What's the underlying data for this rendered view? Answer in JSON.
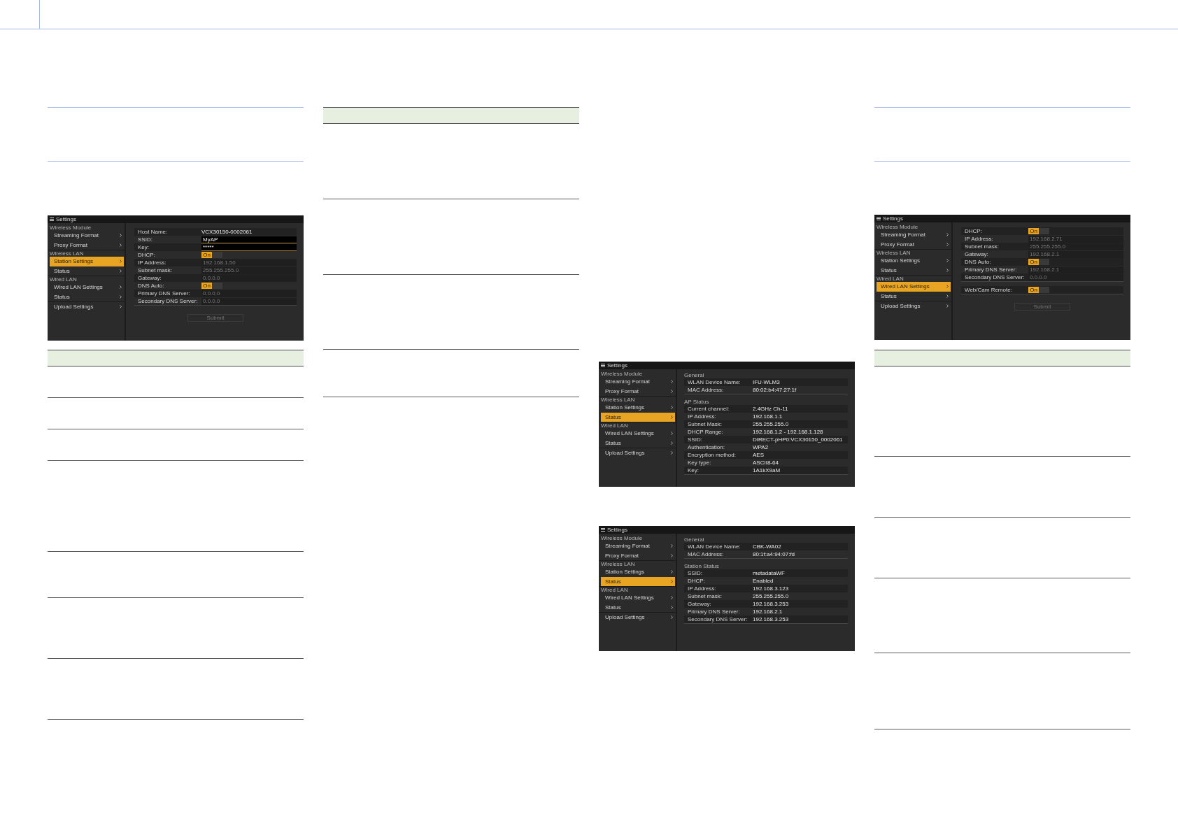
{
  "screenshots": [
    {
      "title": "Settings",
      "sidebar": [
        {
          "heading": "Wireless Module",
          "items": [
            {
              "label": "Streaming Format",
              "selected": false
            },
            {
              "label": "Proxy Format",
              "selected": false
            }
          ]
        },
        {
          "heading": "Wireless LAN",
          "items": [
            {
              "label": "Station Settings",
              "selected": true
            },
            {
              "label": "Status",
              "selected": false
            }
          ]
        },
        {
          "heading": "Wired LAN",
          "items": [
            {
              "label": "Wired LAN Settings",
              "selected": false
            },
            {
              "label": "Status",
              "selected": false
            }
          ]
        },
        {
          "items": [
            {
              "label": "Upload Settings",
              "selected": false
            }
          ]
        }
      ],
      "panel": {
        "kind": "form",
        "sections": [
          {
            "rows": [
              {
                "kind": "static",
                "label": "Host Name:",
                "value": "VCX30150-0002061"
              },
              {
                "kind": "input",
                "label": "SSID:",
                "value": "MyAP",
                "disabled": false
              },
              {
                "kind": "input",
                "label": "Key:",
                "value": "*****",
                "disabled": false
              },
              {
                "kind": "toggle",
                "label": "DHCP:",
                "text": "On",
                "on": true
              },
              {
                "kind": "input",
                "label": "IP Address:",
                "value": "192.168.1.50",
                "disabled": true
              },
              {
                "kind": "input",
                "label": "Subnet mask:",
                "value": "255.255.255.0",
                "disabled": true
              },
              {
                "kind": "input",
                "label": "Gateway:",
                "value": "0.0.0.0",
                "disabled": true
              },
              {
                "kind": "toggle",
                "label": "DNS Auto:",
                "text": "On",
                "on": true
              },
              {
                "kind": "input",
                "label": "Primary DNS Server:",
                "value": "0.0.0.0",
                "disabled": true
              },
              {
                "kind": "input",
                "label": "Secondary DNS Server:",
                "value": "0.0.0.0",
                "disabled": true
              }
            ]
          }
        ],
        "submit": {
          "label": "Submit",
          "disabled": true
        }
      }
    },
    {
      "title": "Settings",
      "sidebar": [
        {
          "heading": "Wireless Module",
          "items": [
            {
              "label": "Streaming Format",
              "selected": false
            },
            {
              "label": "Proxy Format",
              "selected": false
            }
          ]
        },
        {
          "heading": "Wireless LAN",
          "items": [
            {
              "label": "Station Settings",
              "selected": false
            },
            {
              "label": "Status",
              "selected": true
            }
          ]
        },
        {
          "heading": "Wired LAN",
          "items": [
            {
              "label": "Wired LAN Settings",
              "selected": false
            },
            {
              "label": "Status",
              "selected": false
            }
          ]
        },
        {
          "items": [
            {
              "label": "Upload Settings",
              "selected": false
            }
          ]
        }
      ],
      "panel": {
        "kind": "status",
        "sections": [
          {
            "heading": "General",
            "rows": [
              {
                "kind": "static",
                "label": "WLAN Device Name:",
                "value": "IFU-WLM3"
              },
              {
                "kind": "static",
                "label": "MAC Address:",
                "value": "80:02:b4:47:27:1f"
              }
            ]
          },
          {
            "heading": "AP Status",
            "rows": [
              {
                "kind": "static",
                "label": "Current channel:",
                "value": "2.4GHz Ch-11"
              },
              {
                "kind": "static",
                "label": "IP Address:",
                "value": "192.168.1.1"
              },
              {
                "kind": "static",
                "label": "Subnet Mask:",
                "value": "255.255.255.0"
              },
              {
                "kind": "static",
                "label": "DHCP Range:",
                "value": "192.168.1.2 - 192.168.1.128"
              },
              {
                "kind": "static",
                "label": "SSID:",
                "value": "DIRECT-pHP0:VCX30150_0002061"
              },
              {
                "kind": "static",
                "label": "Authentication:",
                "value": "WPA2"
              },
              {
                "kind": "static",
                "label": "Encryption method:",
                "value": "AES"
              },
              {
                "kind": "static",
                "label": "Key type:",
                "value": "ASCII8-64"
              },
              {
                "kind": "static",
                "label": "Key:",
                "value": "1A1kX9aM"
              }
            ]
          }
        ]
      }
    },
    {
      "title": "Settings",
      "sidebar": [
        {
          "heading": "Wireless Module",
          "items": [
            {
              "label": "Streaming Format",
              "selected": false
            },
            {
              "label": "Proxy Format",
              "selected": false
            }
          ]
        },
        {
          "heading": "Wireless LAN",
          "items": [
            {
              "label": "Station Settings",
              "selected": false
            },
            {
              "label": "Status",
              "selected": true
            }
          ]
        },
        {
          "heading": "Wired LAN",
          "items": [
            {
              "label": "Wired LAN Settings",
              "selected": false
            },
            {
              "label": "Status",
              "selected": false
            }
          ]
        },
        {
          "items": [
            {
              "label": "Upload Settings",
              "selected": false
            }
          ]
        }
      ],
      "panel": {
        "kind": "status",
        "sections": [
          {
            "heading": "General",
            "rows": [
              {
                "kind": "static",
                "label": "WLAN Device Name:",
                "value": "CBK-WA02"
              },
              {
                "kind": "static",
                "label": "MAC Address:",
                "value": "80:1f:a4:94:07:fd"
              }
            ]
          },
          {
            "heading": "Station Status",
            "rows": [
              {
                "kind": "static",
                "label": "SSID:",
                "value": "metadataWF"
              },
              {
                "kind": "static",
                "label": "DHCP:",
                "value": "Enabled"
              },
              {
                "kind": "static",
                "label": "IP Address:",
                "value": "192.168.3.123"
              },
              {
                "kind": "static",
                "label": "Subnet mask:",
                "value": "255.255.255.0"
              },
              {
                "kind": "static",
                "label": "Gateway:",
                "value": "192.168.3.253"
              },
              {
                "kind": "static",
                "label": "Primary DNS Server:",
                "value": "192.168.2.1"
              },
              {
                "kind": "static",
                "label": "Secondary DNS Server:",
                "value": "192.168.3.253"
              }
            ]
          }
        ]
      }
    },
    {
      "title": "Settings",
      "sidebar": [
        {
          "heading": "Wireless Module",
          "items": [
            {
              "label": "Streaming Format",
              "selected": false
            },
            {
              "label": "Proxy Format",
              "selected": false
            }
          ]
        },
        {
          "heading": "Wireless LAN",
          "items": [
            {
              "label": "Station Settings",
              "selected": false
            },
            {
              "label": "Status",
              "selected": false
            }
          ]
        },
        {
          "heading": "Wired LAN",
          "items": [
            {
              "label": "Wired LAN Settings",
              "selected": true
            },
            {
              "label": "Status",
              "selected": false
            }
          ]
        },
        {
          "items": [
            {
              "label": "Upload Settings",
              "selected": false
            }
          ]
        }
      ],
      "panel": {
        "kind": "form",
        "sections": [
          {
            "rows": [
              {
                "kind": "toggle",
                "label": "DHCP:",
                "text": "On",
                "on": true
              },
              {
                "kind": "input",
                "label": "IP Address:",
                "value": "192.168.2.71",
                "disabled": true
              },
              {
                "kind": "input",
                "label": "Subnet mask:",
                "value": "255.255.255.0",
                "disabled": true
              },
              {
                "kind": "input",
                "label": "Gateway:",
                "value": "192.168.2.1",
                "disabled": true
              },
              {
                "kind": "toggle",
                "label": "DNS Auto:",
                "text": "On",
                "on": true
              },
              {
                "kind": "input",
                "label": "Primary DNS Server:",
                "value": "192.168.2.1",
                "disabled": true
              },
              {
                "kind": "input",
                "label": "Secondary DNS Server:",
                "value": "0.0.0.0",
                "disabled": true
              }
            ]
          },
          {
            "rows": [
              {
                "kind": "toggle",
                "label": "Web/Cam Remote:",
                "text": "On",
                "on": true
              }
            ]
          }
        ],
        "submit": {
          "label": "Submit",
          "disabled": true
        }
      }
    }
  ]
}
